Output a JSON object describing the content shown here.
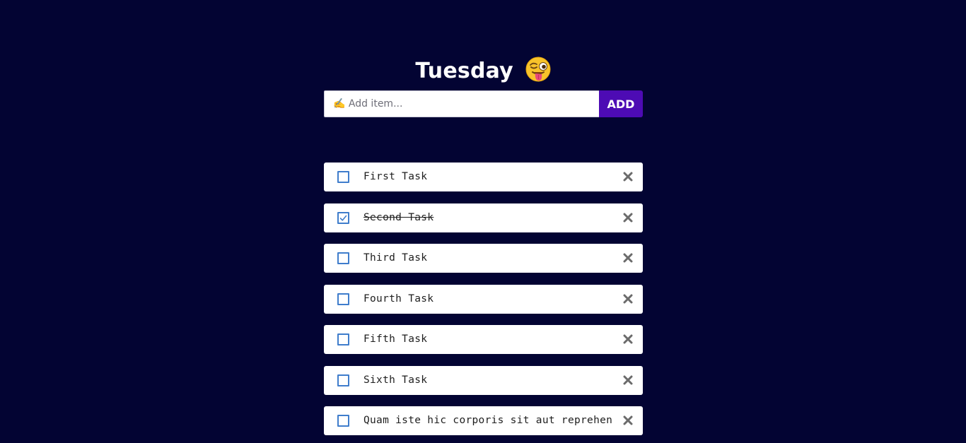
{
  "header": {
    "title": "Tuesday",
    "emoji": "winking-face-with-tongue-icon"
  },
  "add_form": {
    "placeholder": "✍️ Add item...",
    "value": "",
    "button_label": "ADD"
  },
  "tasks": [
    {
      "label": "First Task",
      "done": false
    },
    {
      "label": "Second Task",
      "done": true
    },
    {
      "label": "Third Task",
      "done": false
    },
    {
      "label": "Fourth Task",
      "done": false
    },
    {
      "label": "Fifth Task",
      "done": false
    },
    {
      "label": "Sixth Task",
      "done": false
    },
    {
      "label": "Quam iste hic corporis sit aut reprehen",
      "done": false
    }
  ],
  "colors": {
    "background": "#030433",
    "accent": "#4d0bb4",
    "checkbox": "#3f7dcc",
    "delete_icon": "#6b6b6b"
  }
}
